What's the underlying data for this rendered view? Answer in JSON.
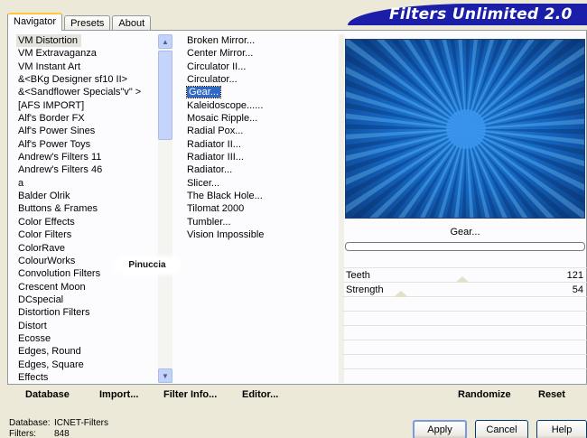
{
  "tabs": [
    "Navigator",
    "Presets",
    "About"
  ],
  "active_tab": "Navigator",
  "title": "Filters Unlimited 2.0",
  "categories": [
    "VM Distortion",
    "VM Extravaganza",
    "VM Instant Art",
    "&<BKg Designer sf10 II>",
    "&<Sandflower Specials\"v\" >",
    "[AFS IMPORT]",
    "Alf's Border FX",
    "Alf's Power Sines",
    "Alf's Power Toys",
    "Andrew's Filters 11",
    "Andrew's Filters 46",
    "a",
    "Balder Olrik",
    "Buttons & Frames",
    "Color Effects",
    "Color Filters",
    "ColorRave",
    "ColourWorks",
    "Convolution Filters",
    "Crescent Moon",
    "DCspecial",
    "Distortion Filters",
    "Distort",
    "Ecosse",
    "Edges, Round",
    "Edges, Square",
    "Effects"
  ],
  "selected_category": "VM Distortion",
  "filters": [
    "Broken Mirror...",
    "Center Mirror...",
    "Circulator II...",
    "Circulator...",
    "Gear...",
    "Kaleidoscope......",
    "Mosaic Ripple...",
    "Radial Pox...",
    "Radiator II...",
    "Radiator III...",
    "Radiator...",
    "Slicer...",
    "The Black Hole...",
    "Tilomat 2000",
    "Tumbler...",
    "Vision Impossible"
  ],
  "selected_filter": "Gear...",
  "preview_label": "Gear...",
  "watermark": "Pinuccia",
  "params": [
    {
      "name": "Teeth",
      "value": "121",
      "level": 0.475
    },
    {
      "name": "Strength",
      "value": "54",
      "level": 0.212
    }
  ],
  "toolbar": {
    "database": "Database",
    "import": "Import...",
    "filter_info": "Filter Info...",
    "editor": "Editor...",
    "randomize": "Randomize",
    "reset": "Reset"
  },
  "status": {
    "database_label": "Database:",
    "database_value": "ICNET-Filters",
    "filters_label": "Filters:",
    "filters_value": "848"
  },
  "buttons": {
    "apply": "Apply",
    "cancel": "Cancel",
    "help": "Help"
  },
  "colors": {
    "banner": "#1a1ea8",
    "selection": "#316ac5",
    "preview_blue": "#1468c4"
  }
}
